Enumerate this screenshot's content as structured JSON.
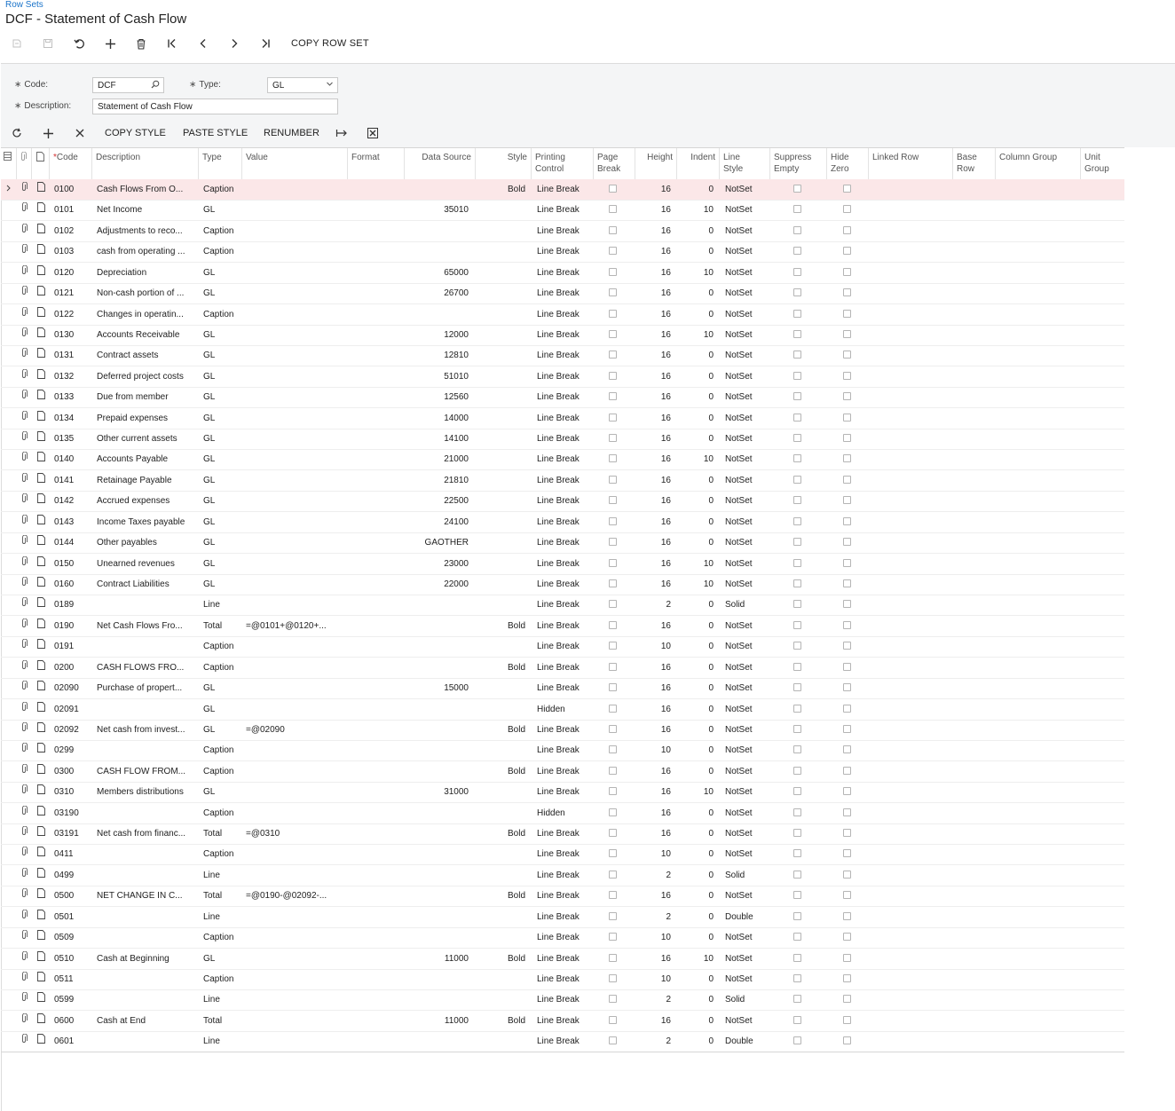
{
  "breadcrumb": "Row Sets",
  "title": "DCF - Statement of Cash Flow",
  "toolbar": {
    "copy_row_set": "COPY ROW SET"
  },
  "form": {
    "code_label": "Code:",
    "code_value": "DCF",
    "type_label": "Type:",
    "type_value": "GL",
    "description_label": "Description:",
    "description_value": "Statement of Cash Flow"
  },
  "grid_toolbar": {
    "copy_style": "COPY STYLE",
    "paste_style": "PASTE STYLE",
    "renumber": "RENUMBER"
  },
  "columns": {
    "code": "Code",
    "description": "Description",
    "type": "Type",
    "value": "Value",
    "format": "Format",
    "data_source": "Data Source",
    "style": "Style",
    "printing_control_1": "Printing",
    "printing_control_2": "Control",
    "page_break_1": "Page",
    "page_break_2": "Break",
    "height": "Height",
    "indent": "Indent",
    "line_style_1": "Line",
    "line_style_2": "Style",
    "suppress_empty_1": "Suppress",
    "suppress_empty_2": "Empty",
    "hide_zero_1": "Hide",
    "hide_zero_2": "Zero",
    "linked_row": "Linked Row",
    "base_row_1": "Base",
    "base_row_2": "Row",
    "column_group": "Column Group",
    "unit_group_1": "Unit",
    "unit_group_2": "Group"
  },
  "rows": [
    {
      "code": "0100",
      "desc": "Cash Flows From O...",
      "type": "Caption",
      "value": "",
      "ds": "",
      "style": "Bold",
      "pc": "Line Break",
      "height": "16",
      "indent": "0",
      "ls": "NotSet"
    },
    {
      "code": "0101",
      "desc": "Net Income",
      "type": "GL",
      "value": "",
      "ds": "35010",
      "style": "",
      "pc": "Line Break",
      "height": "16",
      "indent": "10",
      "ls": "NotSet"
    },
    {
      "code": "0102",
      "desc": "Adjustments to reco...",
      "type": "Caption",
      "value": "",
      "ds": "",
      "style": "",
      "pc": "Line Break",
      "height": "16",
      "indent": "0",
      "ls": "NotSet"
    },
    {
      "code": "0103",
      "desc": "cash from operating ...",
      "type": "Caption",
      "value": "",
      "ds": "",
      "style": "",
      "pc": "Line Break",
      "height": "16",
      "indent": "0",
      "ls": "NotSet"
    },
    {
      "code": "0120",
      "desc": "Depreciation",
      "type": "GL",
      "value": "",
      "ds": "65000",
      "style": "",
      "pc": "Line Break",
      "height": "16",
      "indent": "10",
      "ls": "NotSet"
    },
    {
      "code": "0121",
      "desc": "Non-cash portion of ...",
      "type": "GL",
      "value": "",
      "ds": "26700",
      "style": "",
      "pc": "Line Break",
      "height": "16",
      "indent": "0",
      "ls": "NotSet"
    },
    {
      "code": "0122",
      "desc": "Changes in operatin...",
      "type": "Caption",
      "value": "",
      "ds": "",
      "style": "",
      "pc": "Line Break",
      "height": "16",
      "indent": "0",
      "ls": "NotSet"
    },
    {
      "code": "0130",
      "desc": "Accounts Receivable",
      "type": "GL",
      "value": "",
      "ds": "12000",
      "style": "",
      "pc": "Line Break",
      "height": "16",
      "indent": "10",
      "ls": "NotSet"
    },
    {
      "code": "0131",
      "desc": "Contract assets",
      "type": "GL",
      "value": "",
      "ds": "12810",
      "style": "",
      "pc": "Line Break",
      "height": "16",
      "indent": "0",
      "ls": "NotSet"
    },
    {
      "code": "0132",
      "desc": "Deferred project costs",
      "type": "GL",
      "value": "",
      "ds": "51010",
      "style": "",
      "pc": "Line Break",
      "height": "16",
      "indent": "0",
      "ls": "NotSet"
    },
    {
      "code": "0133",
      "desc": "Due from member",
      "type": "GL",
      "value": "",
      "ds": "12560",
      "style": "",
      "pc": "Line Break",
      "height": "16",
      "indent": "0",
      "ls": "NotSet"
    },
    {
      "code": "0134",
      "desc": "Prepaid expenses",
      "type": "GL",
      "value": "",
      "ds": "14000",
      "style": "",
      "pc": "Line Break",
      "height": "16",
      "indent": "0",
      "ls": "NotSet"
    },
    {
      "code": "0135",
      "desc": "Other current assets",
      "type": "GL",
      "value": "",
      "ds": "14100",
      "style": "",
      "pc": "Line Break",
      "height": "16",
      "indent": "0",
      "ls": "NotSet"
    },
    {
      "code": "0140",
      "desc": "Accounts Payable",
      "type": "GL",
      "value": "",
      "ds": "21000",
      "style": "",
      "pc": "Line Break",
      "height": "16",
      "indent": "10",
      "ls": "NotSet"
    },
    {
      "code": "0141",
      "desc": "Retainage Payable",
      "type": "GL",
      "value": "",
      "ds": "21810",
      "style": "",
      "pc": "Line Break",
      "height": "16",
      "indent": "0",
      "ls": "NotSet"
    },
    {
      "code": "0142",
      "desc": "Accrued expenses",
      "type": "GL",
      "value": "",
      "ds": "22500",
      "style": "",
      "pc": "Line Break",
      "height": "16",
      "indent": "0",
      "ls": "NotSet"
    },
    {
      "code": "0143",
      "desc": "Income Taxes payable",
      "type": "GL",
      "value": "",
      "ds": "24100",
      "style": "",
      "pc": "Line Break",
      "height": "16",
      "indent": "0",
      "ls": "NotSet"
    },
    {
      "code": "0144",
      "desc": "Other payables",
      "type": "GL",
      "value": "",
      "ds": "GAOTHER",
      "style": "",
      "pc": "Line Break",
      "height": "16",
      "indent": "0",
      "ls": "NotSet"
    },
    {
      "code": "0150",
      "desc": "Unearned revenues",
      "type": "GL",
      "value": "",
      "ds": "23000",
      "style": "",
      "pc": "Line Break",
      "height": "16",
      "indent": "10",
      "ls": "NotSet"
    },
    {
      "code": "0160",
      "desc": "Contract Liabilities",
      "type": "GL",
      "value": "",
      "ds": "22000",
      "style": "",
      "pc": "Line Break",
      "height": "16",
      "indent": "10",
      "ls": "NotSet"
    },
    {
      "code": "0189",
      "desc": "",
      "type": "Line",
      "value": "",
      "ds": "",
      "style": "",
      "pc": "Line Break",
      "height": "2",
      "indent": "0",
      "ls": "Solid"
    },
    {
      "code": "0190",
      "desc": "Net Cash Flows Fro...",
      "type": "Total",
      "value": "=@0101+@0120+...",
      "ds": "",
      "style": "Bold",
      "pc": "Line Break",
      "height": "16",
      "indent": "0",
      "ls": "NotSet"
    },
    {
      "code": "0191",
      "desc": "",
      "type": "Caption",
      "value": "",
      "ds": "",
      "style": "",
      "pc": "Line Break",
      "height": "10",
      "indent": "0",
      "ls": "NotSet"
    },
    {
      "code": "0200",
      "desc": "CASH FLOWS FRO...",
      "type": "Caption",
      "value": "",
      "ds": "",
      "style": "Bold",
      "pc": "Line Break",
      "height": "16",
      "indent": "0",
      "ls": "NotSet"
    },
    {
      "code": "02090",
      "desc": "Purchase of propert...",
      "type": "GL",
      "value": "",
      "ds": "15000",
      "style": "",
      "pc": "Line Break",
      "height": "16",
      "indent": "0",
      "ls": "NotSet"
    },
    {
      "code": "02091",
      "desc": "",
      "type": "GL",
      "value": "",
      "ds": "",
      "style": "",
      "pc": "Hidden",
      "height": "16",
      "indent": "0",
      "ls": "NotSet"
    },
    {
      "code": "02092",
      "desc": "Net cash from invest...",
      "type": "GL",
      "value": "=@02090",
      "ds": "",
      "style": "Bold",
      "pc": "Line Break",
      "height": "16",
      "indent": "0",
      "ls": "NotSet"
    },
    {
      "code": "0299",
      "desc": "",
      "type": "Caption",
      "value": "",
      "ds": "",
      "style": "",
      "pc": "Line Break",
      "height": "10",
      "indent": "0",
      "ls": "NotSet"
    },
    {
      "code": "0300",
      "desc": "CASH FLOW FROM...",
      "type": "Caption",
      "value": "",
      "ds": "",
      "style": "Bold",
      "pc": "Line Break",
      "height": "16",
      "indent": "0",
      "ls": "NotSet"
    },
    {
      "code": "0310",
      "desc": "Members distributions",
      "type": "GL",
      "value": "",
      "ds": "31000",
      "style": "",
      "pc": "Line Break",
      "height": "16",
      "indent": "10",
      "ls": "NotSet"
    },
    {
      "code": "03190",
      "desc": "",
      "type": "Caption",
      "value": "",
      "ds": "",
      "style": "",
      "pc": "Hidden",
      "height": "16",
      "indent": "0",
      "ls": "NotSet"
    },
    {
      "code": "03191",
      "desc": "Net cash from financ...",
      "type": "Total",
      "value": "=@0310",
      "ds": "",
      "style": "Bold",
      "pc": "Line Break",
      "height": "16",
      "indent": "0",
      "ls": "NotSet"
    },
    {
      "code": "0411",
      "desc": "",
      "type": "Caption",
      "value": "",
      "ds": "",
      "style": "",
      "pc": "Line Break",
      "height": "10",
      "indent": "0",
      "ls": "NotSet"
    },
    {
      "code": "0499",
      "desc": "",
      "type": "Line",
      "value": "",
      "ds": "",
      "style": "",
      "pc": "Line Break",
      "height": "2",
      "indent": "0",
      "ls": "Solid"
    },
    {
      "code": "0500",
      "desc": "NET CHANGE IN C...",
      "type": "Total",
      "value": "=@0190-@02092-...",
      "ds": "",
      "style": "Bold",
      "pc": "Line Break",
      "height": "16",
      "indent": "0",
      "ls": "NotSet"
    },
    {
      "code": "0501",
      "desc": "",
      "type": "Line",
      "value": "",
      "ds": "",
      "style": "",
      "pc": "Line Break",
      "height": "2",
      "indent": "0",
      "ls": "Double"
    },
    {
      "code": "0509",
      "desc": "",
      "type": "Caption",
      "value": "",
      "ds": "",
      "style": "",
      "pc": "Line Break",
      "height": "10",
      "indent": "0",
      "ls": "NotSet"
    },
    {
      "code": "0510",
      "desc": "Cash at Beginning",
      "type": "GL",
      "value": "",
      "ds": "11000",
      "style": "Bold",
      "pc": "Line Break",
      "height": "16",
      "indent": "10",
      "ls": "NotSet"
    },
    {
      "code": "0511",
      "desc": "",
      "type": "Caption",
      "value": "",
      "ds": "",
      "style": "",
      "pc": "Line Break",
      "height": "10",
      "indent": "0",
      "ls": "NotSet"
    },
    {
      "code": "0599",
      "desc": "",
      "type": "Line",
      "value": "",
      "ds": "",
      "style": "",
      "pc": "Line Break",
      "height": "2",
      "indent": "0",
      "ls": "Solid"
    },
    {
      "code": "0600",
      "desc": "Cash at End",
      "type": "Total",
      "value": "",
      "ds": "11000",
      "style": "Bold",
      "pc": "Line Break",
      "height": "16",
      "indent": "0",
      "ls": "NotSet"
    },
    {
      "code": "0601",
      "desc": "",
      "type": "Line",
      "value": "",
      "ds": "",
      "style": "",
      "pc": "Line Break",
      "height": "2",
      "indent": "0",
      "ls": "Double"
    }
  ]
}
